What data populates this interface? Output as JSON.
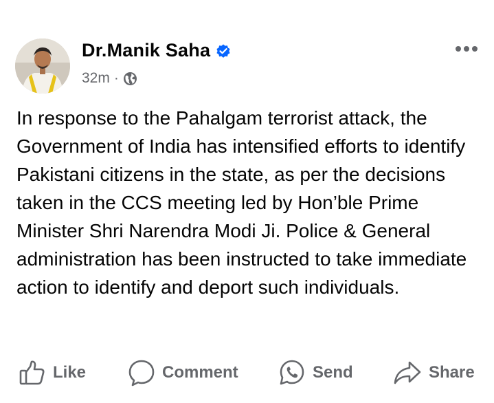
{
  "post": {
    "author": "Dr.Manik Saha",
    "time": "32m",
    "separator": "·",
    "text": "In response to the Pahalgam terrorist attack, the Government of India has intensified efforts to identify Pakistani citizens in the state, as per the decisions taken in the CCS meeting led by Hon’ble Prime Minister Shri Narendra Modi Ji. Police & General administration has been instructed to take immediate action to identify and deport such individuals."
  },
  "actions": {
    "like": "Like",
    "comment": "Comment",
    "send": "Send",
    "share": "Share"
  },
  "icons": {
    "verified": "verified-badge-icon",
    "audience": "globe-icon",
    "more": "more-options-icon"
  },
  "colors": {
    "verified_blue": "#0866ff",
    "secondary_text": "#65676b",
    "primary_text": "#050505"
  }
}
